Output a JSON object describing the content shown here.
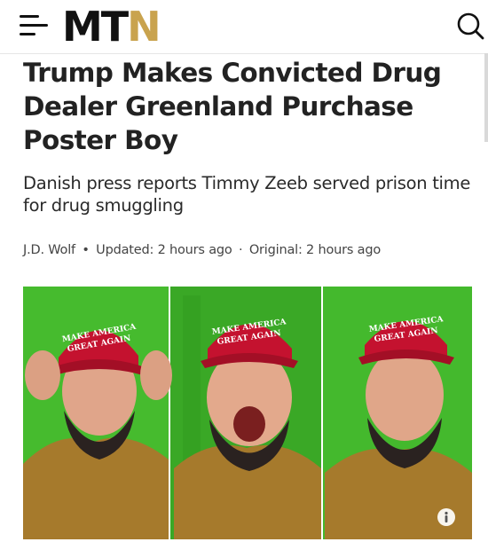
{
  "header": {
    "logo": {
      "part1": "MT",
      "part2": "N"
    },
    "menu_icon": "hamburger-menu-icon",
    "search_icon": "search-icon",
    "accent_color": "#c9a34e"
  },
  "article": {
    "title": "Trump Makes Convicted Drug Dealer Greenland Purchase Poster Boy",
    "subtitle": "Danish press reports Timmy Zeeb served prison time for drug smuggling",
    "byline": {
      "author": "J.D. Wolf",
      "bullet": "•",
      "updated": "Updated: 2 hours ago",
      "dot": "·",
      "original": "Original: 2 hours ago"
    },
    "image": {
      "hat_text_line1": "MAKE AMERICA",
      "hat_text_line2": "GREAT AGAIN",
      "info_icon": "info-icon",
      "colors": {
        "green_screen": "#3fb52b",
        "hat_red": "#c4122f",
        "jacket": "#a67a2c"
      }
    }
  }
}
